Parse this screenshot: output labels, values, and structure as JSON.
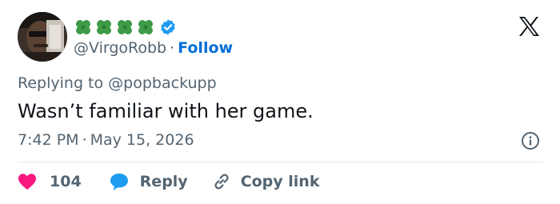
{
  "author": {
    "handle": "@VirgoRobb",
    "follow_label": "Follow",
    "separator": "·",
    "name_icons": [
      "four-leaf-clover-icon",
      "four-leaf-clover-icon",
      "four-leaf-clover-icon",
      "four-leaf-clover-icon"
    ],
    "badge_icon": "verified-badge-icon"
  },
  "reply_context": {
    "prefix": "Replying to",
    "mention": "@popbackupp"
  },
  "tweet": {
    "text": "Wasn’t familiar with her game.",
    "time": "7:42 PM",
    "separator": "·",
    "date": "May 15, 2026"
  },
  "actions": {
    "like_count": "104",
    "reply_label": "Reply",
    "copy_label": "Copy link"
  },
  "icons": {
    "brand": "x-logo-icon",
    "info": "info-icon",
    "like": "heart-icon",
    "reply": "speech-bubble-icon",
    "copy": "link-icon"
  },
  "colors": {
    "follow": "#006fd6",
    "verified": "#1d9bf0",
    "clover": "#3e9b47",
    "heart": "#f91880",
    "reply_bubble": "#1d9bf0",
    "secondary_text": "#536471",
    "primary_text": "#0f1419"
  }
}
